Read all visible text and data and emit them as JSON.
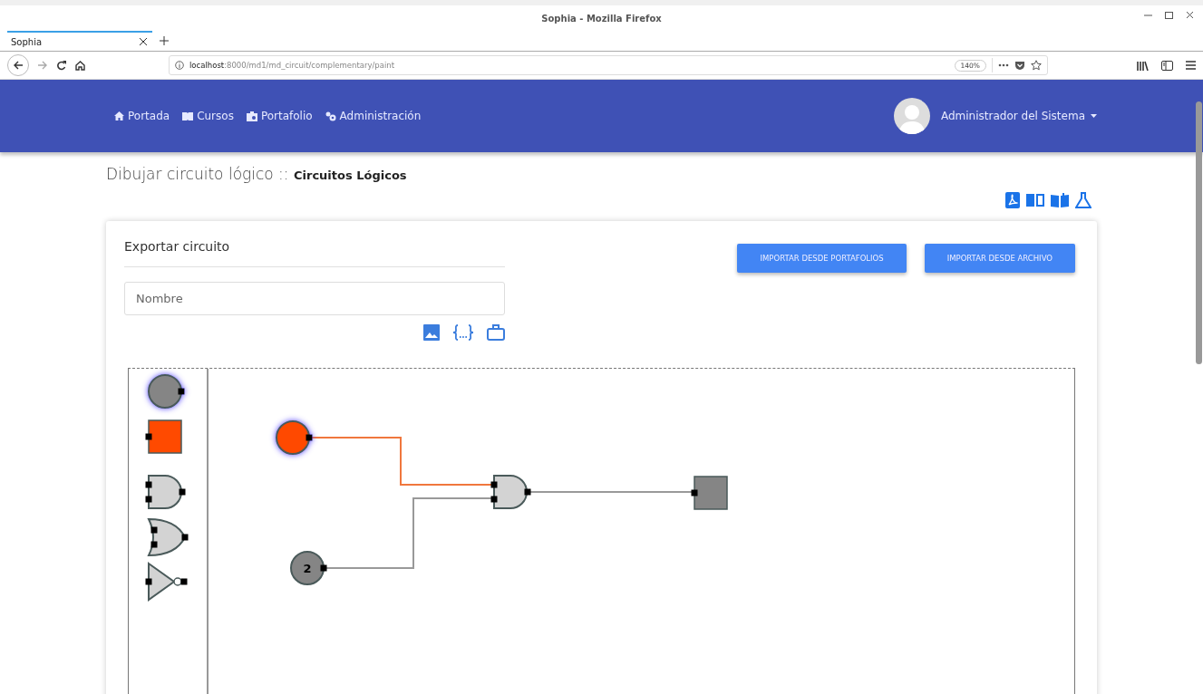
{
  "window": {
    "title": "Sophia - Mozilla Firefox"
  },
  "tabs": [
    {
      "label": "Sophia",
      "selected": true
    }
  ],
  "address_bar": {
    "host": "localhost",
    "path": ":8000/md1/md_circuit/complementary/paint",
    "zoom": "140%"
  },
  "nav": {
    "items": [
      {
        "label": "Portada",
        "kind": "home"
      },
      {
        "label": "Cursos",
        "kind": "book"
      },
      {
        "label": "Portafolio",
        "kind": "case"
      },
      {
        "label": "Administración",
        "kind": "gears"
      }
    ],
    "user": "Administrador del Sistema"
  },
  "page": {
    "title": "Dibujar circuito lógico ::",
    "subtitle": "Circuitos Lógicos"
  },
  "export": {
    "heading": "Exportar circuito",
    "name_field": {
      "placeholder": "Nombre"
    },
    "format_icons": [
      {
        "kind": "image"
      },
      {
        "kind": "braces"
      },
      {
        "kind": "case"
      }
    ]
  },
  "buttons": [
    "IMPORTAR DESDE PORTAFOLIOS",
    "IMPORTAR DESDE ARCHIVO"
  ],
  "palette": [
    {
      "kind": "input",
      "on": false,
      "selected": true
    },
    {
      "kind": "output",
      "on": true
    },
    {
      "kind": "and"
    },
    {
      "kind": "or"
    },
    {
      "kind": "not"
    }
  ],
  "circuit": {
    "nodes": [
      {
        "kind": "input",
        "on": true,
        "selected": true
      },
      {
        "kind": "input",
        "on": false,
        "selected": false,
        "label": "2"
      },
      {
        "kind": "and"
      },
      {
        "kind": "output",
        "on": false
      }
    ],
    "wires": [
      {
        "on": true
      },
      {
        "on": false
      },
      {
        "on": false
      }
    ]
  }
}
